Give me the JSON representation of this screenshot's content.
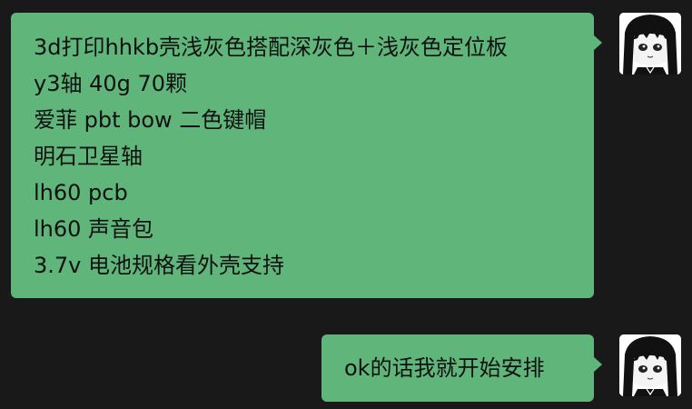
{
  "messages": [
    {
      "sender": "self",
      "lines": [
        "3d打印hhkb壳浅灰色搭配深灰色＋浅灰色定位板",
        "y3轴 40g 70颗",
        "爱菲 pbt bow 二色键帽",
        "明石卫星轴",
        "lh60 pcb",
        "lh60 声音包",
        "3.7v 电池规格看外壳支持"
      ]
    },
    {
      "sender": "self",
      "lines": [
        "ok的话我就开始安排"
      ]
    }
  ],
  "colors": {
    "background": "#191919",
    "bubble": "#5fb57a",
    "text": "#111111"
  },
  "avatar_icon": "anime-girl-avatar-icon"
}
